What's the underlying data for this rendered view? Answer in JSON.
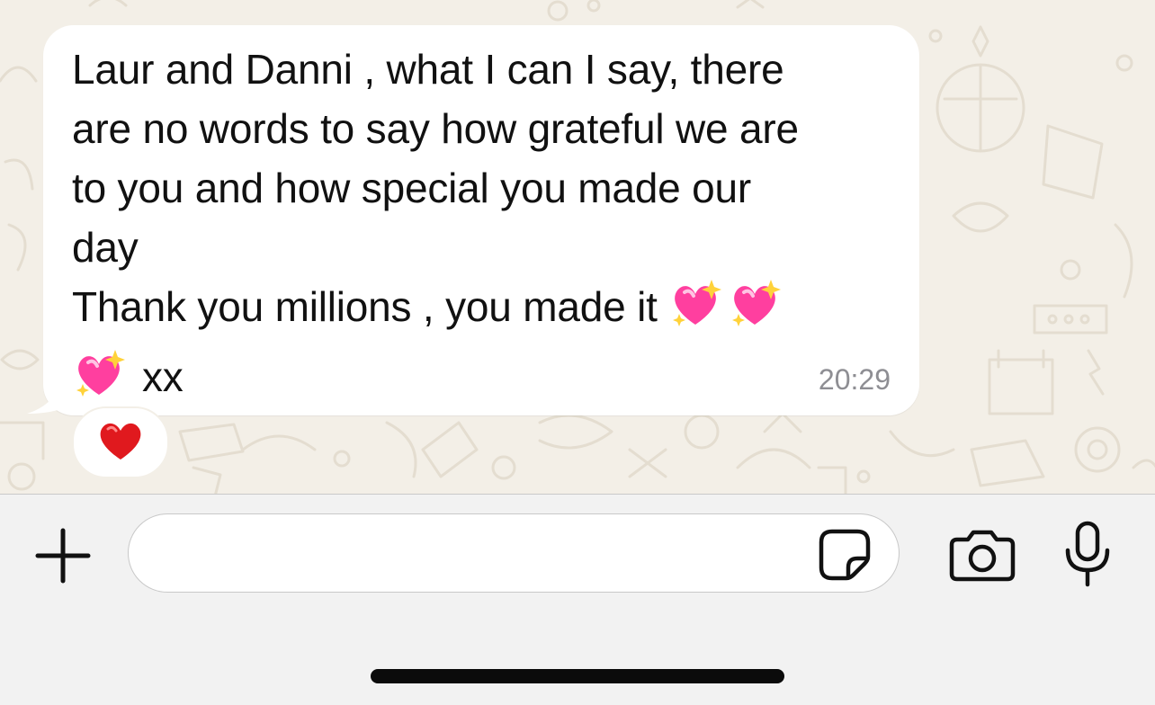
{
  "message": {
    "lines": [
      "Laur and Danni , what I can I say, there",
      "are no words to say how grateful we are",
      "to you and how special you made our",
      "day",
      "Thank you millions , you made it",
      "xx"
    ],
    "emojis": [
      "sparkling-heart",
      "sparkling-heart",
      "sparkling-heart"
    ],
    "time": "20:29",
    "reaction": "red-heart"
  },
  "input": {
    "placeholder": "",
    "value": ""
  },
  "toolbar": {
    "icons": [
      "plus-icon",
      "sticker-icon",
      "camera-icon",
      "microphone-icon"
    ]
  },
  "colors": {
    "chat_background": "#f3efe7",
    "bubble": "#ffffff",
    "input_bar": "#f2f2f2",
    "timestamp": "#8e8e93",
    "heart": "#e0191e",
    "sparkling_heart": "#ff3f9f"
  }
}
